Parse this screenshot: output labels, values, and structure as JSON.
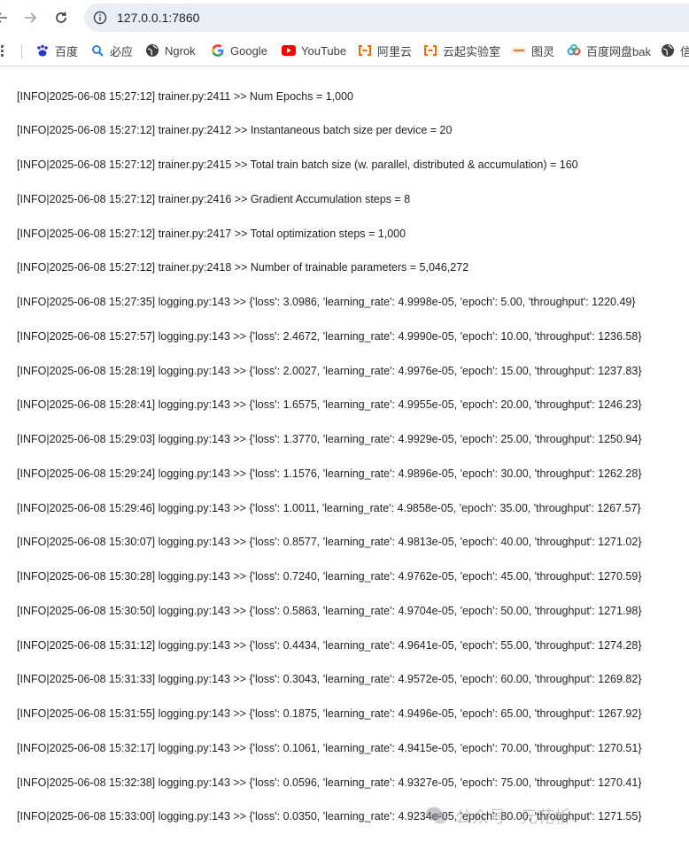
{
  "browser": {
    "url": "127.0.0.1:7860"
  },
  "bookmarks": [
    {
      "label": "百度",
      "icon": "baidu-paw-icon"
    },
    {
      "label": "必应",
      "icon": "search-icon"
    },
    {
      "label": "Ngrok",
      "icon": "globe-icon"
    },
    {
      "label": "Google",
      "icon": "google-icon"
    },
    {
      "label": "YouTube",
      "icon": "youtube-icon"
    },
    {
      "label": "阿里云",
      "icon": "aliyun-icon"
    },
    {
      "label": "云起实验室",
      "icon": "aliyun-icon"
    },
    {
      "label": "图灵",
      "icon": "turing-icon"
    },
    {
      "label": "百度网盘bak",
      "icon": "baidu-netdisk-icon"
    },
    {
      "label": "信",
      "icon": "globe-icon"
    }
  ],
  "log_lines": [
    "[INFO|2025-06-08 15:27:12] trainer.py:2411 >> Num Epochs = 1,000",
    "[INFO|2025-06-08 15:27:12] trainer.py:2412 >> Instantaneous batch size per device = 20",
    "[INFO|2025-06-08 15:27:12] trainer.py:2415 >> Total train batch size (w. parallel, distributed & accumulation) = 160",
    "[INFO|2025-06-08 15:27:12] trainer.py:2416 >> Gradient Accumulation steps = 8",
    "[INFO|2025-06-08 15:27:12] trainer.py:2417 >> Total optimization steps = 1,000",
    "[INFO|2025-06-08 15:27:12] trainer.py:2418 >> Number of trainable parameters = 5,046,272",
    "[INFO|2025-06-08 15:27:35] logging.py:143 >> {'loss': 3.0986, 'learning_rate': 4.9998e-05, 'epoch': 5.00, 'throughput': 1220.49}",
    "[INFO|2025-06-08 15:27:57] logging.py:143 >> {'loss': 2.4672, 'learning_rate': 4.9990e-05, 'epoch': 10.00, 'throughput': 1236.58}",
    "[INFO|2025-06-08 15:28:19] logging.py:143 >> {'loss': 2.0027, 'learning_rate': 4.9976e-05, 'epoch': 15.00, 'throughput': 1237.83}",
    "[INFO|2025-06-08 15:28:41] logging.py:143 >> {'loss': 1.6575, 'learning_rate': 4.9955e-05, 'epoch': 20.00, 'throughput': 1246.23}",
    "[INFO|2025-06-08 15:29:03] logging.py:143 >> {'loss': 1.3770, 'learning_rate': 4.9929e-05, 'epoch': 25.00, 'throughput': 1250.94}",
    "[INFO|2025-06-08 15:29:24] logging.py:143 >> {'loss': 1.1576, 'learning_rate': 4.9896e-05, 'epoch': 30.00, 'throughput': 1262.28}",
    "[INFO|2025-06-08 15:29:46] logging.py:143 >> {'loss': 1.0011, 'learning_rate': 4.9858e-05, 'epoch': 35.00, 'throughput': 1267.57}",
    "[INFO|2025-06-08 15:30:07] logging.py:143 >> {'loss': 0.8577, 'learning_rate': 4.9813e-05, 'epoch': 40.00, 'throughput': 1271.02}",
    "[INFO|2025-06-08 15:30:28] logging.py:143 >> {'loss': 0.7240, 'learning_rate': 4.9762e-05, 'epoch': 45.00, 'throughput': 1270.59}",
    "[INFO|2025-06-08 15:30:50] logging.py:143 >> {'loss': 0.5863, 'learning_rate': 4.9704e-05, 'epoch': 50.00, 'throughput': 1271.98}",
    "[INFO|2025-06-08 15:31:12] logging.py:143 >> {'loss': 0.4434, 'learning_rate': 4.9641e-05, 'epoch': 55.00, 'throughput': 1274.28}",
    "[INFO|2025-06-08 15:31:33] logging.py:143 >> {'loss': 0.3043, 'learning_rate': 4.9572e-05, 'epoch': 60.00, 'throughput': 1269.82}",
    "[INFO|2025-06-08 15:31:55] logging.py:143 >> {'loss': 0.1875, 'learning_rate': 4.9496e-05, 'epoch': 65.00, 'throughput': 1267.92}",
    "[INFO|2025-06-08 15:32:17] logging.py:143 >> {'loss': 0.1061, 'learning_rate': 4.9415e-05, 'epoch': 70.00, 'throughput': 1270.51}",
    "[INFO|2025-06-08 15:32:38] logging.py:143 >> {'loss': 0.0596, 'learning_rate': 4.9327e-05, 'epoch': 75.00, 'throughput': 1270.41}",
    "[INFO|2025-06-08 15:33:00] logging.py:143 >> {'loss': 0.0350, 'learning_rate': 4.9234e-05, 'epoch': 80.00, 'throughput': 1271.55}"
  ],
  "watermark": "公众号 · 元花析"
}
